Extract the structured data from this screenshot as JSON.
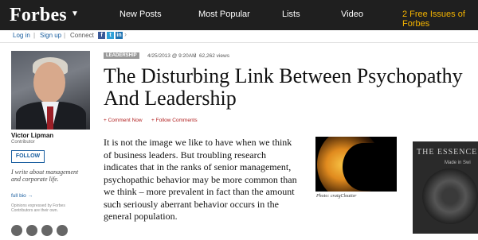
{
  "header": {
    "logo": "Forbes",
    "nav": [
      "New Posts",
      "Most Popular",
      "Lists",
      "Video"
    ],
    "promo": "2 Free Issues of Forbes"
  },
  "subbar": {
    "login": "Log in",
    "signup": "Sign up",
    "connect": "Connect",
    "social": [
      "f",
      "t",
      "in"
    ]
  },
  "author": {
    "name": "Victor Lipman",
    "role": "Contributor",
    "follow_label": "FOLLOW",
    "bio": "I write about management and corporate life.",
    "full_bio_label": "full bio →",
    "disclaimer": "Opinions expressed by Forbes Contributors are their own."
  },
  "article": {
    "tag": "LEADERSHIP",
    "date": "4/25/2013 @ 9:20AM",
    "views": "62,262 views",
    "title": "The Disturbing Link Between Psychopathy And Leadership",
    "comment_now": "+ Comment Now",
    "follow_comments": "+ Follow Comments",
    "body": "It is not the image we like to have when we think of business leaders. But troubling research indicates that in the ranks of senior management, psychopathic behavior may be more common than we think – more prevalent in fact than the amount such seriously aberrant behavior occurs in the general population.",
    "photo_credit": "Photo: craigCloutier"
  },
  "ad": {
    "title": "THE ESSENCE",
    "subtitle": "Made in Swi"
  }
}
